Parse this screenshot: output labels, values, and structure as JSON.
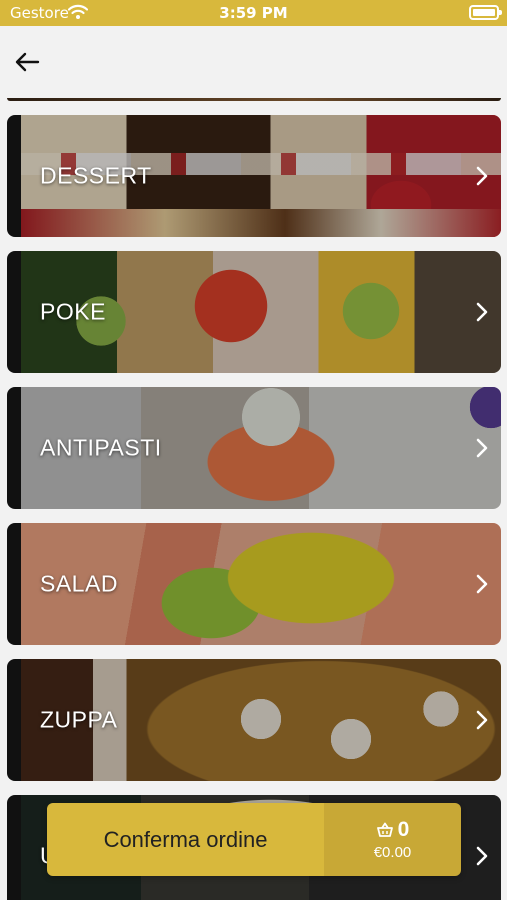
{
  "status_bar": {
    "carrier": "Gestore",
    "time": "3:59 PM",
    "icons": [
      "wifi-icon",
      "battery-icon"
    ]
  },
  "nav": {
    "back_icon": "arrow-left-icon"
  },
  "categories": [
    {
      "label": "DESSERT"
    },
    {
      "label": "POKE"
    },
    {
      "label": "ANTIPASTI"
    },
    {
      "label": "SALAD"
    },
    {
      "label": "ZUPPA"
    },
    {
      "label": "U"
    }
  ],
  "cart": {
    "confirm_label": "Conferma ordine",
    "count": "0",
    "total": "€0.00",
    "icon": "basket-icon"
  },
  "colors": {
    "accent": "#d8b83c",
    "accent_dark": "#c8a836",
    "background": "#f2f2f2"
  }
}
